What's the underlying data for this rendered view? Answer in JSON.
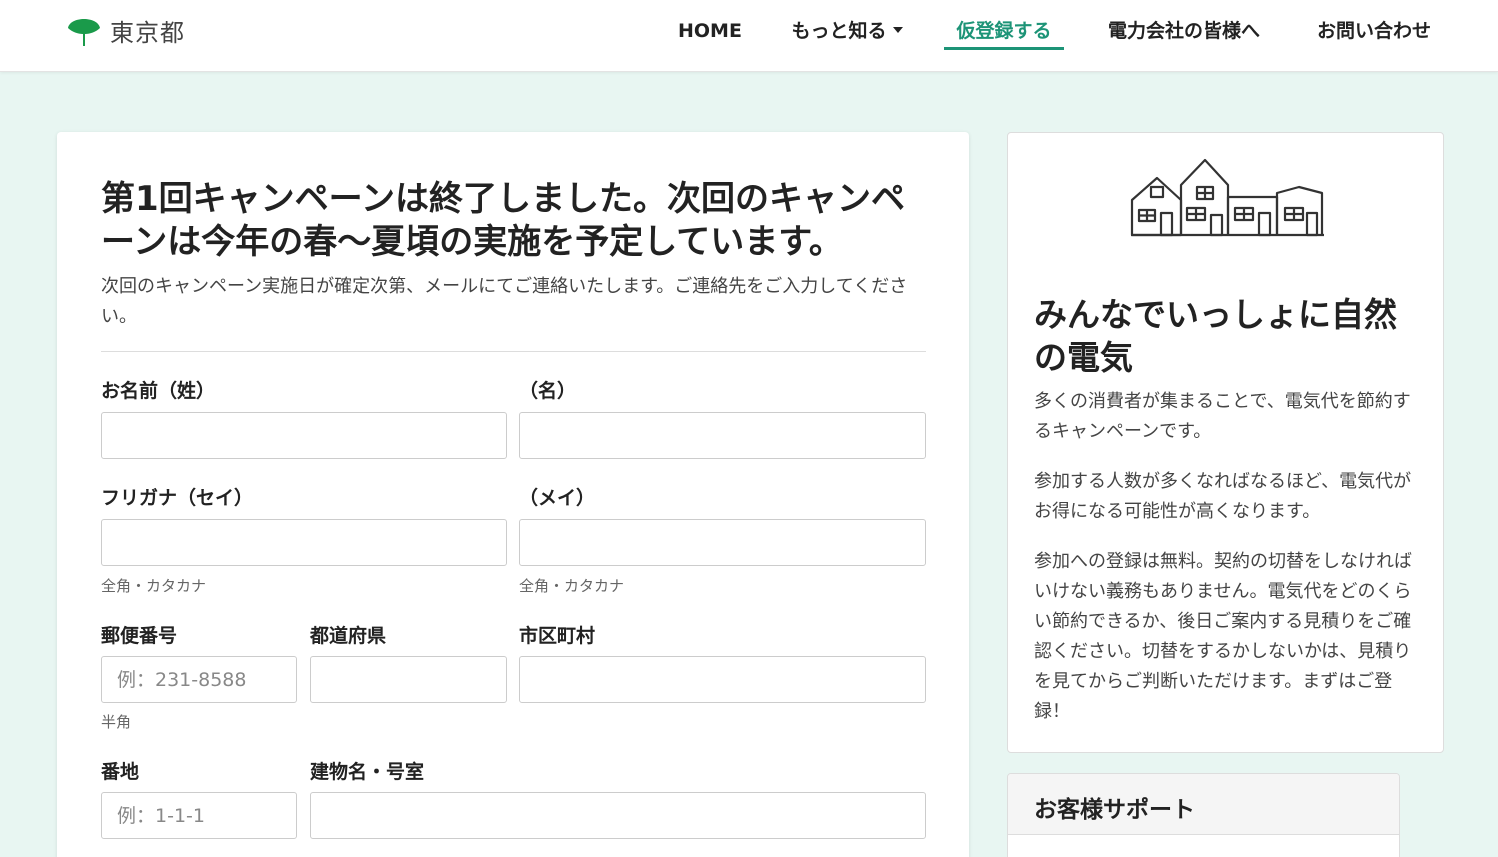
{
  "header": {
    "logo_text": "東京都",
    "nav": [
      {
        "label": "HOME"
      },
      {
        "label": "もっと知る"
      },
      {
        "label": "仮登録する"
      },
      {
        "label": "電力会社の皆様へ"
      },
      {
        "label": "お問い合わせ"
      }
    ],
    "active_nav": "仮登録する"
  },
  "main": {
    "title": "第1回キャンペーンは終了しました。次回のキャンペーンは今年の春〜夏頃の実施を予定しています。",
    "description": "次回のキャンペーン実施日が確定次第、メールにてご連絡いたします。ご連絡先をご入力してください。",
    "form": {
      "last_name_label": "お名前（姓）",
      "first_name_label": "（名）",
      "last_kana_label": "フリガナ（セイ）",
      "first_kana_label": "（メイ）",
      "kana_hint_1": "全角・カタカナ",
      "kana_hint_2": "全角・カタカナ",
      "postal_label": "郵便番号",
      "postal_placeholder": "例：231-8588",
      "postal_hint": "半角",
      "prefecture_label": "都道府県",
      "city_label": "市区町村",
      "address_label": "番地",
      "address_placeholder": "例：1-1-1",
      "building_label": "建物名・号室"
    }
  },
  "sidebar": {
    "title": "みんなでいっしょに自然の電気",
    "paragraphs": [
      "多くの消費者が集まることで、電気代を節約するキャンペーンです。",
      "参加する人数が多くなればなるほど、電気代がお得になる可能性が高くなります。",
      "参加への登録は無料。契約の切替をしなければいけない義務もありません。電気代をどのくらい節約できるか、後日ご案内する見積りをご確認ください。切替をするかしないかは、見積りを見てからご判断いただけます。まずはご登録！"
    ],
    "illustration_icon": "houses-icon"
  },
  "support": {
    "title": "お客様サポート"
  },
  "colors": {
    "accent": "#1d9477",
    "background": "#e8f6f2",
    "logo_green": "#1a9a4a"
  }
}
